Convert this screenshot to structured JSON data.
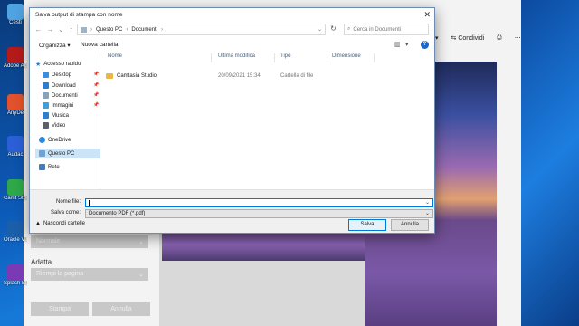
{
  "desktop": {
    "icons": [
      {
        "label": "Cesti",
        "color": "#4fa3e0"
      },
      {
        "label": "Adobe Ac Edition",
        "color": "#b51a1a"
      },
      {
        "label": "AnyDe",
        "color": "#e2522c"
      },
      {
        "label": "Audac",
        "color": "#2a5fd8"
      },
      {
        "label": "Camt Studi",
        "color": "#2ea84a"
      },
      {
        "label": "Oracle Virtua",
        "color": "#1b5fab"
      },
      {
        "label": "Splash Busin",
        "color": "#7a3ab5"
      }
    ]
  },
  "background_app": {
    "share_label": "Condividi",
    "left_select_value": "Normale",
    "fit_label": "Adatta",
    "fit_select_value": "Riempi la pagina",
    "print_button": "Stampa",
    "cancel_button": "Annulla"
  },
  "dialog": {
    "title": "Salva output di stampa con nome",
    "close_glyph": "✕",
    "breadcrumb": [
      "Questo PC",
      "Documenti"
    ],
    "search_placeholder": "Cerca in Documenti",
    "organize_label": "Organizza ▾",
    "new_folder_label": "Nuova cartella",
    "help_glyph": "?",
    "nav": {
      "quick_access": "Accesso rapido",
      "items": [
        {
          "label": "Desktop",
          "color": "#3b8de0",
          "pinned": "📌"
        },
        {
          "label": "Download",
          "color": "#2a7bd4",
          "pinned": "📌"
        },
        {
          "label": "Documenti",
          "color": "#8a9fb8",
          "pinned": "📌"
        },
        {
          "label": "Immagini",
          "color": "#3fa0d8",
          "pinned": "📌"
        },
        {
          "label": "Musica",
          "color": "#2f7fcf",
          "pinned": ""
        },
        {
          "label": "Video",
          "color": "#5a5f6a",
          "pinned": ""
        }
      ],
      "onedrive": "OneDrive",
      "this_pc": "Questo PC",
      "network": "Rete"
    },
    "columns": [
      "Nome",
      "Ultima modifica",
      "Tipo",
      "Dimensione"
    ],
    "files": [
      {
        "name": "Camtasia Studio",
        "modified": "20/09/2021 15:34",
        "type": "Cartella di file",
        "size": ""
      }
    ],
    "filename_label": "Nome file:",
    "filename_value": "",
    "savetype_label": "Salva come:",
    "savetype_value": "Documento PDF (*.pdf)",
    "hide_folders_label": "Nascondi cartelle",
    "save_button": "Salva",
    "cancel_button": "Annulla"
  }
}
